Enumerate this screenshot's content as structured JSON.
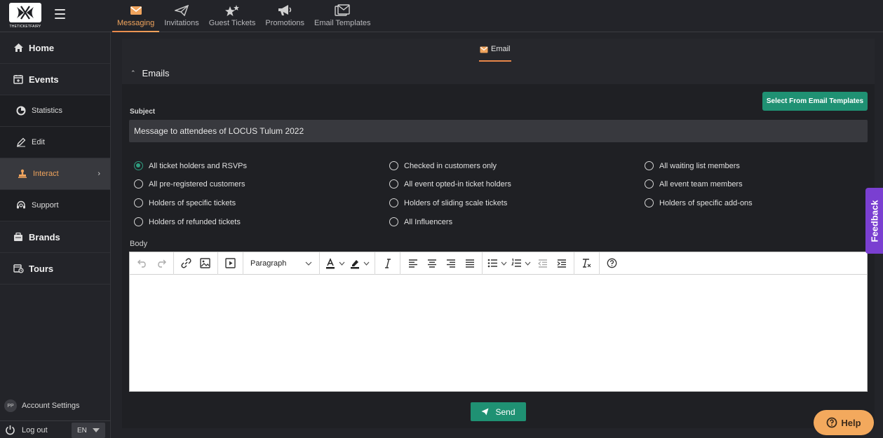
{
  "brand": {
    "logo_text": "THETICKETFAIRY"
  },
  "top_tabs": [
    {
      "label": "Messaging",
      "icon": "mail-icon",
      "active": true
    },
    {
      "label": "Invitations",
      "icon": "paper-plane-icon"
    },
    {
      "label": "Guest Tickets",
      "icon": "stars-icon"
    },
    {
      "label": "Promotions",
      "icon": "megaphone-icon"
    },
    {
      "label": "Email Templates",
      "icon": "mail-template-icon"
    }
  ],
  "sidebar": {
    "items": [
      {
        "label": "Home",
        "icon": "home-icon"
      },
      {
        "label": "Events",
        "icon": "calendar-icon"
      },
      {
        "label": "Statistics",
        "icon": "pie-chart-icon"
      },
      {
        "label": "Edit",
        "icon": "pencil-icon"
      },
      {
        "label": "Interact",
        "icon": "stamp-icon",
        "active": true
      },
      {
        "label": "Support",
        "icon": "headset-icon"
      },
      {
        "label": "Brands",
        "icon": "brands-icon"
      },
      {
        "label": "Tours",
        "icon": "tours-icon"
      }
    ],
    "account": {
      "initials": "PP",
      "label": "Account Settings"
    },
    "logout_label": "Log out",
    "language": "EN"
  },
  "main": {
    "tab_label": "Email",
    "section_title": "Emails",
    "select_template_label": "Select From Email Templates",
    "subject_label": "Subject",
    "subject_value": "Message to attendees of LOCUS Tulum 2022",
    "recipients": [
      {
        "label": "All ticket holders and RSVPs",
        "checked": true
      },
      {
        "label": "Checked in customers only"
      },
      {
        "label": "All waiting list members"
      },
      {
        "label": "All pre-registered customers"
      },
      {
        "label": "All event opted-in ticket holders"
      },
      {
        "label": "All event team members"
      },
      {
        "label": "Holders of specific tickets"
      },
      {
        "label": "Holders of sliding scale tickets"
      },
      {
        "label": "Holders of specific add-ons"
      },
      {
        "label": "Holders of refunded tickets"
      },
      {
        "label": "All Influencers"
      }
    ],
    "body_label": "Body",
    "editor": {
      "block_format": "Paragraph"
    },
    "send_label": "Send"
  },
  "feedback_label": "Feedback",
  "help_label": "Help",
  "colors": {
    "accent": "#f0a45d",
    "primary": "#1f9173",
    "feedback": "#7a3fd1",
    "help": "#f3a95d"
  }
}
